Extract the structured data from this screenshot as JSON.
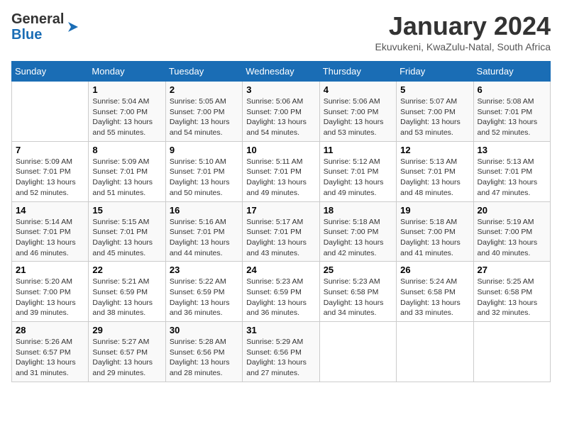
{
  "header": {
    "logo_line1": "General",
    "logo_line2": "Blue",
    "month": "January 2024",
    "location": "Ekuvukeni, KwaZulu-Natal, South Africa"
  },
  "days_of_week": [
    "Sunday",
    "Monday",
    "Tuesday",
    "Wednesday",
    "Thursday",
    "Friday",
    "Saturday"
  ],
  "weeks": [
    [
      {
        "num": "",
        "text": ""
      },
      {
        "num": "1",
        "text": "Sunrise: 5:04 AM\nSunset: 7:00 PM\nDaylight: 13 hours\nand 55 minutes."
      },
      {
        "num": "2",
        "text": "Sunrise: 5:05 AM\nSunset: 7:00 PM\nDaylight: 13 hours\nand 54 minutes."
      },
      {
        "num": "3",
        "text": "Sunrise: 5:06 AM\nSunset: 7:00 PM\nDaylight: 13 hours\nand 54 minutes."
      },
      {
        "num": "4",
        "text": "Sunrise: 5:06 AM\nSunset: 7:00 PM\nDaylight: 13 hours\nand 53 minutes."
      },
      {
        "num": "5",
        "text": "Sunrise: 5:07 AM\nSunset: 7:00 PM\nDaylight: 13 hours\nand 53 minutes."
      },
      {
        "num": "6",
        "text": "Sunrise: 5:08 AM\nSunset: 7:01 PM\nDaylight: 13 hours\nand 52 minutes."
      }
    ],
    [
      {
        "num": "7",
        "text": "Sunrise: 5:09 AM\nSunset: 7:01 PM\nDaylight: 13 hours\nand 52 minutes."
      },
      {
        "num": "8",
        "text": "Sunrise: 5:09 AM\nSunset: 7:01 PM\nDaylight: 13 hours\nand 51 minutes."
      },
      {
        "num": "9",
        "text": "Sunrise: 5:10 AM\nSunset: 7:01 PM\nDaylight: 13 hours\nand 50 minutes."
      },
      {
        "num": "10",
        "text": "Sunrise: 5:11 AM\nSunset: 7:01 PM\nDaylight: 13 hours\nand 49 minutes."
      },
      {
        "num": "11",
        "text": "Sunrise: 5:12 AM\nSunset: 7:01 PM\nDaylight: 13 hours\nand 49 minutes."
      },
      {
        "num": "12",
        "text": "Sunrise: 5:13 AM\nSunset: 7:01 PM\nDaylight: 13 hours\nand 48 minutes."
      },
      {
        "num": "13",
        "text": "Sunrise: 5:13 AM\nSunset: 7:01 PM\nDaylight: 13 hours\nand 47 minutes."
      }
    ],
    [
      {
        "num": "14",
        "text": "Sunrise: 5:14 AM\nSunset: 7:01 PM\nDaylight: 13 hours\nand 46 minutes."
      },
      {
        "num": "15",
        "text": "Sunrise: 5:15 AM\nSunset: 7:01 PM\nDaylight: 13 hours\nand 45 minutes."
      },
      {
        "num": "16",
        "text": "Sunrise: 5:16 AM\nSunset: 7:01 PM\nDaylight: 13 hours\nand 44 minutes."
      },
      {
        "num": "17",
        "text": "Sunrise: 5:17 AM\nSunset: 7:01 PM\nDaylight: 13 hours\nand 43 minutes."
      },
      {
        "num": "18",
        "text": "Sunrise: 5:18 AM\nSunset: 7:00 PM\nDaylight: 13 hours\nand 42 minutes."
      },
      {
        "num": "19",
        "text": "Sunrise: 5:18 AM\nSunset: 7:00 PM\nDaylight: 13 hours\nand 41 minutes."
      },
      {
        "num": "20",
        "text": "Sunrise: 5:19 AM\nSunset: 7:00 PM\nDaylight: 13 hours\nand 40 minutes."
      }
    ],
    [
      {
        "num": "21",
        "text": "Sunrise: 5:20 AM\nSunset: 7:00 PM\nDaylight: 13 hours\nand 39 minutes."
      },
      {
        "num": "22",
        "text": "Sunrise: 5:21 AM\nSunset: 6:59 PM\nDaylight: 13 hours\nand 38 minutes."
      },
      {
        "num": "23",
        "text": "Sunrise: 5:22 AM\nSunset: 6:59 PM\nDaylight: 13 hours\nand 36 minutes."
      },
      {
        "num": "24",
        "text": "Sunrise: 5:23 AM\nSunset: 6:59 PM\nDaylight: 13 hours\nand 36 minutes."
      },
      {
        "num": "25",
        "text": "Sunrise: 5:23 AM\nSunset: 6:58 PM\nDaylight: 13 hours\nand 34 minutes."
      },
      {
        "num": "26",
        "text": "Sunrise: 5:24 AM\nSunset: 6:58 PM\nDaylight: 13 hours\nand 33 minutes."
      },
      {
        "num": "27",
        "text": "Sunrise: 5:25 AM\nSunset: 6:58 PM\nDaylight: 13 hours\nand 32 minutes."
      }
    ],
    [
      {
        "num": "28",
        "text": "Sunrise: 5:26 AM\nSunset: 6:57 PM\nDaylight: 13 hours\nand 31 minutes."
      },
      {
        "num": "29",
        "text": "Sunrise: 5:27 AM\nSunset: 6:57 PM\nDaylight: 13 hours\nand 29 minutes."
      },
      {
        "num": "30",
        "text": "Sunrise: 5:28 AM\nSunset: 6:56 PM\nDaylight: 13 hours\nand 28 minutes."
      },
      {
        "num": "31",
        "text": "Sunrise: 5:29 AM\nSunset: 6:56 PM\nDaylight: 13 hours\nand 27 minutes."
      },
      {
        "num": "",
        "text": ""
      },
      {
        "num": "",
        "text": ""
      },
      {
        "num": "",
        "text": ""
      }
    ]
  ]
}
